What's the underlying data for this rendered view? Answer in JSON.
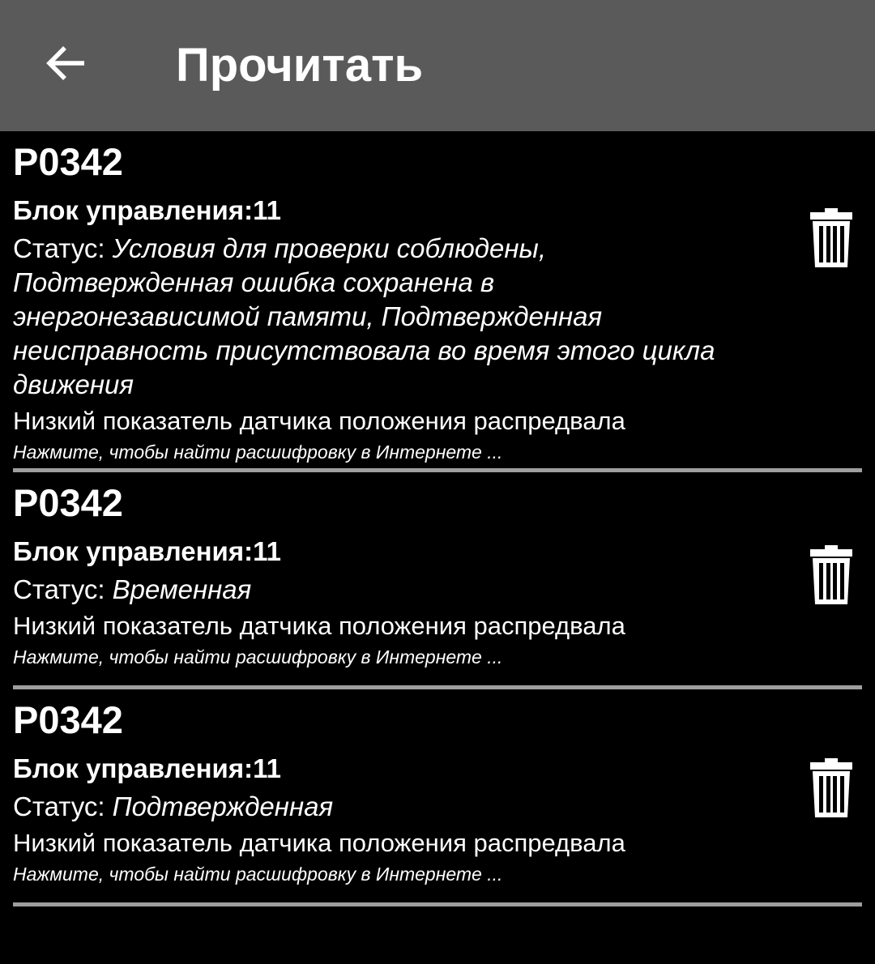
{
  "appbar": {
    "title": "Прочитать",
    "back_icon": "arrow-left-icon"
  },
  "colors": {
    "appbar_bg": "#5a5a5a",
    "background": "#000000",
    "divider": "#9e9e9e",
    "text": "#ffffff"
  },
  "items": [
    {
      "code": "P0342",
      "block_label": "Блок управления:",
      "block_value": "11",
      "status_label": "Статус: ",
      "status_value": "Условия для проверки соблюдены, Подтвержденная ошибка сохранена в энергонезависимой памяти, Подтвержденная неисправность присутствовала во время этого цикла движения",
      "description": "Низкий показатель датчика положения распредвала",
      "link": "Нажмите, чтобы найти расшифровку в Интернете ...",
      "delete_icon": "trash-icon"
    },
    {
      "code": "P0342",
      "block_label": "Блок управления:",
      "block_value": "11",
      "status_label": "Статус: ",
      "status_value": "Временная",
      "description": "Низкий показатель датчика положения распредвала",
      "link": "Нажмите, чтобы найти расшифровку в Интернете ...",
      "delete_icon": "trash-icon"
    },
    {
      "code": "P0342",
      "block_label": "Блок управления:",
      "block_value": "11",
      "status_label": "Статус: ",
      "status_value": "Подтвержденная",
      "description": "Низкий показатель датчика положения распредвала",
      "link": "Нажмите, чтобы найти расшифровку в Интернете ...",
      "delete_icon": "trash-icon"
    }
  ]
}
